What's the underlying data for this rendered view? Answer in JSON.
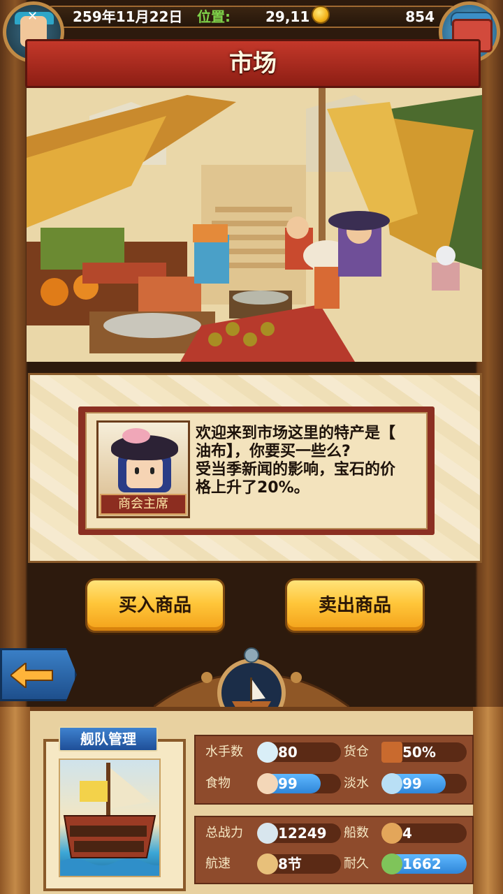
{
  "topbar": {
    "date": "259年11月22日",
    "location_label": "位置:",
    "location_value": "29,11",
    "money": "854"
  },
  "page": {
    "title": "市场"
  },
  "dialog": {
    "speaker": "商会主席",
    "line1": "欢迎来到市场这里的特产是【",
    "line2": "油布】，你要买一些么?",
    "line3": "受当季新闻的影响，宝石的价",
    "line4": "格上升了20%。"
  },
  "buttons": {
    "buy": "买入商品",
    "sell": "卖出商品"
  },
  "fleet": {
    "title": "舰队管理",
    "stats": [
      {
        "label": "水手数",
        "value": "80",
        "icon": "sailor-icon",
        "fill": 0.0
      },
      {
        "label": "货仓",
        "value": "50%",
        "icon": "cargo-icon",
        "fill": 0.0
      },
      {
        "label": "食物",
        "value": "99",
        "icon": "food-icon",
        "fill": 0.75
      },
      {
        "label": "淡水",
        "value": "99",
        "icon": "water-icon",
        "fill": 0.75
      },
      {
        "label": "总战力",
        "value": "12249",
        "icon": "power-icon",
        "fill": 0.0
      },
      {
        "label": "船数",
        "value": "4",
        "icon": "ship-count-icon",
        "fill": 0.0
      },
      {
        "label": "航速",
        "value": "8节",
        "icon": "speed-icon",
        "fill": 0.0
      },
      {
        "label": "耐久",
        "value": "1662",
        "icon": "durability-icon",
        "fill": 1.0
      }
    ]
  },
  "colors": {
    "accent_blue": "#2f86d8",
    "title_red": "#c4382a",
    "button_gold": "#ffc63a",
    "location_green": "#7fd34a"
  }
}
